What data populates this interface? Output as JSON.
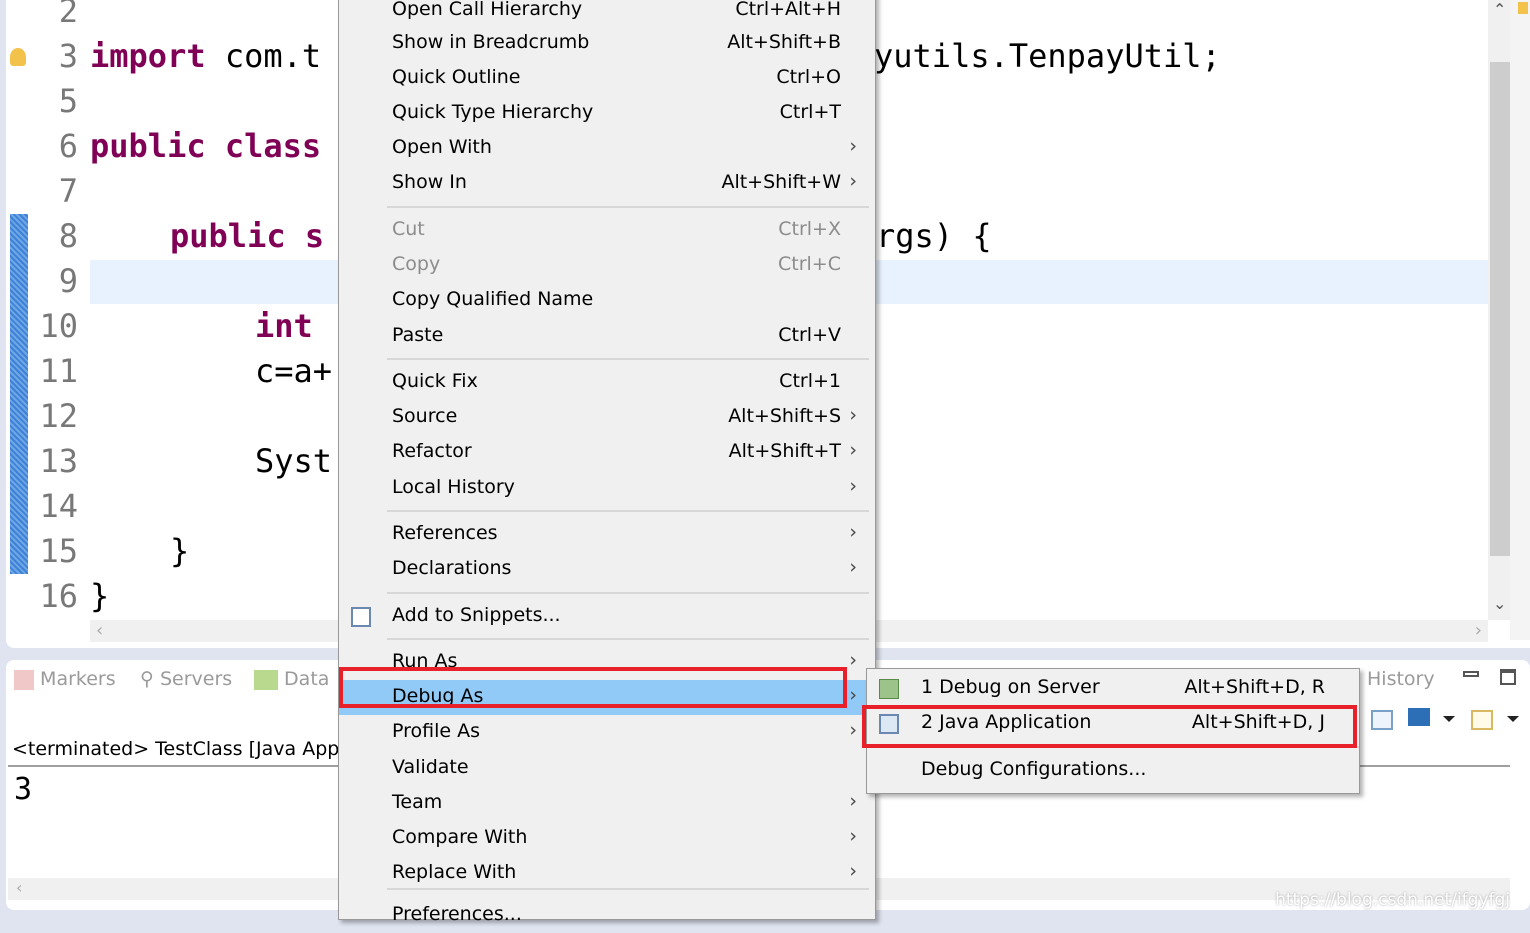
{
  "editor": {
    "lines": [
      {
        "n": "2",
        "code": ""
      },
      {
        "n": "3",
        "kw": "import",
        "code": " com.t",
        "tail": "yutils.TenpayUtil;"
      },
      {
        "n": "5",
        "code": ""
      },
      {
        "n": "6",
        "kw": "public class",
        "code": ""
      },
      {
        "n": "7",
        "code": ""
      },
      {
        "n": "8",
        "kw": "public s",
        "code": "",
        "tail": "rgs) {"
      },
      {
        "n": "9",
        "code": ""
      },
      {
        "n": "10",
        "kw": "int",
        "code": ""
      },
      {
        "n": "11",
        "code": "c=a+"
      },
      {
        "n": "12",
        "code": ""
      },
      {
        "n": "13",
        "code": "Syst"
      },
      {
        "n": "14",
        "code": ""
      },
      {
        "n": "15",
        "code": "}"
      },
      {
        "n": "16",
        "code": "}"
      }
    ]
  },
  "bottom": {
    "tabs": [
      {
        "label": "Markers"
      },
      {
        "label": "Servers"
      },
      {
        "label": "Data"
      },
      {
        "label": "History"
      }
    ],
    "console_header": "<terminated> TestClass [Java Appl",
    "output": "3"
  },
  "context_menu": {
    "items": [
      {
        "label": "Open Call Hierarchy",
        "shortcut": "Ctrl+Alt+H"
      },
      {
        "label": "Show in Breadcrumb",
        "shortcut": "Alt+Shift+B"
      },
      {
        "label": "Quick Outline",
        "shortcut": "Ctrl+O"
      },
      {
        "label": "Quick Type Hierarchy",
        "shortcut": "Ctrl+T"
      },
      {
        "label": "Open With",
        "shortcut": "",
        "submenu": true
      },
      {
        "label": "Show In",
        "shortcut": "Alt+Shift+W",
        "submenu": true
      },
      {
        "label": "Cut",
        "shortcut": "Ctrl+X",
        "disabled": true
      },
      {
        "label": "Copy",
        "shortcut": "Ctrl+C",
        "disabled": true
      },
      {
        "label": "Copy Qualified Name",
        "shortcut": ""
      },
      {
        "label": "Paste",
        "shortcut": "Ctrl+V"
      },
      {
        "label": "Quick Fix",
        "shortcut": "Ctrl+1"
      },
      {
        "label": "Source",
        "shortcut": "Alt+Shift+S",
        "submenu": true
      },
      {
        "label": "Refactor",
        "shortcut": "Alt+Shift+T",
        "submenu": true
      },
      {
        "label": "Local History",
        "shortcut": "",
        "submenu": true
      },
      {
        "label": "References",
        "shortcut": "",
        "submenu": true
      },
      {
        "label": "Declarations",
        "shortcut": "",
        "submenu": true
      },
      {
        "label": "Add to Snippets...",
        "shortcut": ""
      },
      {
        "label": "Run As",
        "shortcut": "",
        "submenu": true
      },
      {
        "label": "Debug As",
        "shortcut": "",
        "submenu": true,
        "highlighted": true
      },
      {
        "label": "Profile As",
        "shortcut": "",
        "submenu": true
      },
      {
        "label": "Validate",
        "shortcut": ""
      },
      {
        "label": "Team",
        "shortcut": "",
        "submenu": true
      },
      {
        "label": "Compare With",
        "shortcut": "",
        "submenu": true
      },
      {
        "label": "Replace With",
        "shortcut": "",
        "submenu": true
      },
      {
        "label": "Preferences...",
        "shortcut": ""
      }
    ]
  },
  "debug_submenu": {
    "items": [
      {
        "label": "1 Debug on Server",
        "shortcut": "Alt+Shift+D, R"
      },
      {
        "label": "2 Java Application",
        "shortcut": "Alt+Shift+D, J"
      },
      {
        "label": "Debug Configurations...",
        "shortcut": ""
      }
    ]
  },
  "colors": {
    "highlight": "#91c9f7",
    "annotation": "#e8202a",
    "keyword": "#7f0055"
  },
  "watermark": "https://blog.csdn.net/ifgyfgj"
}
